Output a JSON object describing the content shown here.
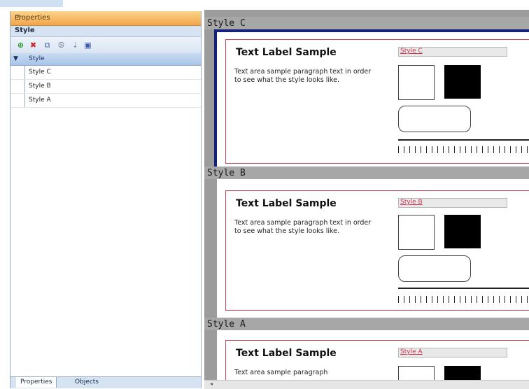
{
  "properties_panel": {
    "title": "Properties",
    "section_title": "Style",
    "toolbar_icons": [
      "add-icon",
      "delete-icon",
      "copy-icon",
      "paste-icon",
      "move-icon",
      "apply-icon"
    ],
    "tree": {
      "root": "Style",
      "items": [
        "Style C",
        "Style B",
        "Style A"
      ]
    },
    "tabs": [
      "Properties",
      "Objects"
    ]
  },
  "preview": {
    "sections": [
      {
        "name": "Style C",
        "label_sample": "Text Label Sample",
        "paragraph": "Text area sample paragraph text in order to see what the style looks like.",
        "ribbon": "Style C"
      },
      {
        "name": "Style B",
        "label_sample": "Text Label Sample",
        "paragraph": "Text area sample paragraph text in order to see what the style looks like.",
        "ribbon": "Style B"
      },
      {
        "name": "Style A",
        "label_sample": "Text Label Sample",
        "paragraph": "Text area sample paragraph",
        "ribbon": "Style A"
      }
    ]
  },
  "colors": {
    "panel_title_bg": "#f3a54a",
    "selection_bg": "#a9c4e8",
    "preview_bg": "#9c9c9c",
    "selected_frame": "#14217a",
    "card_border": "#c44a5a",
    "ribbon_text": "#d0344c"
  }
}
